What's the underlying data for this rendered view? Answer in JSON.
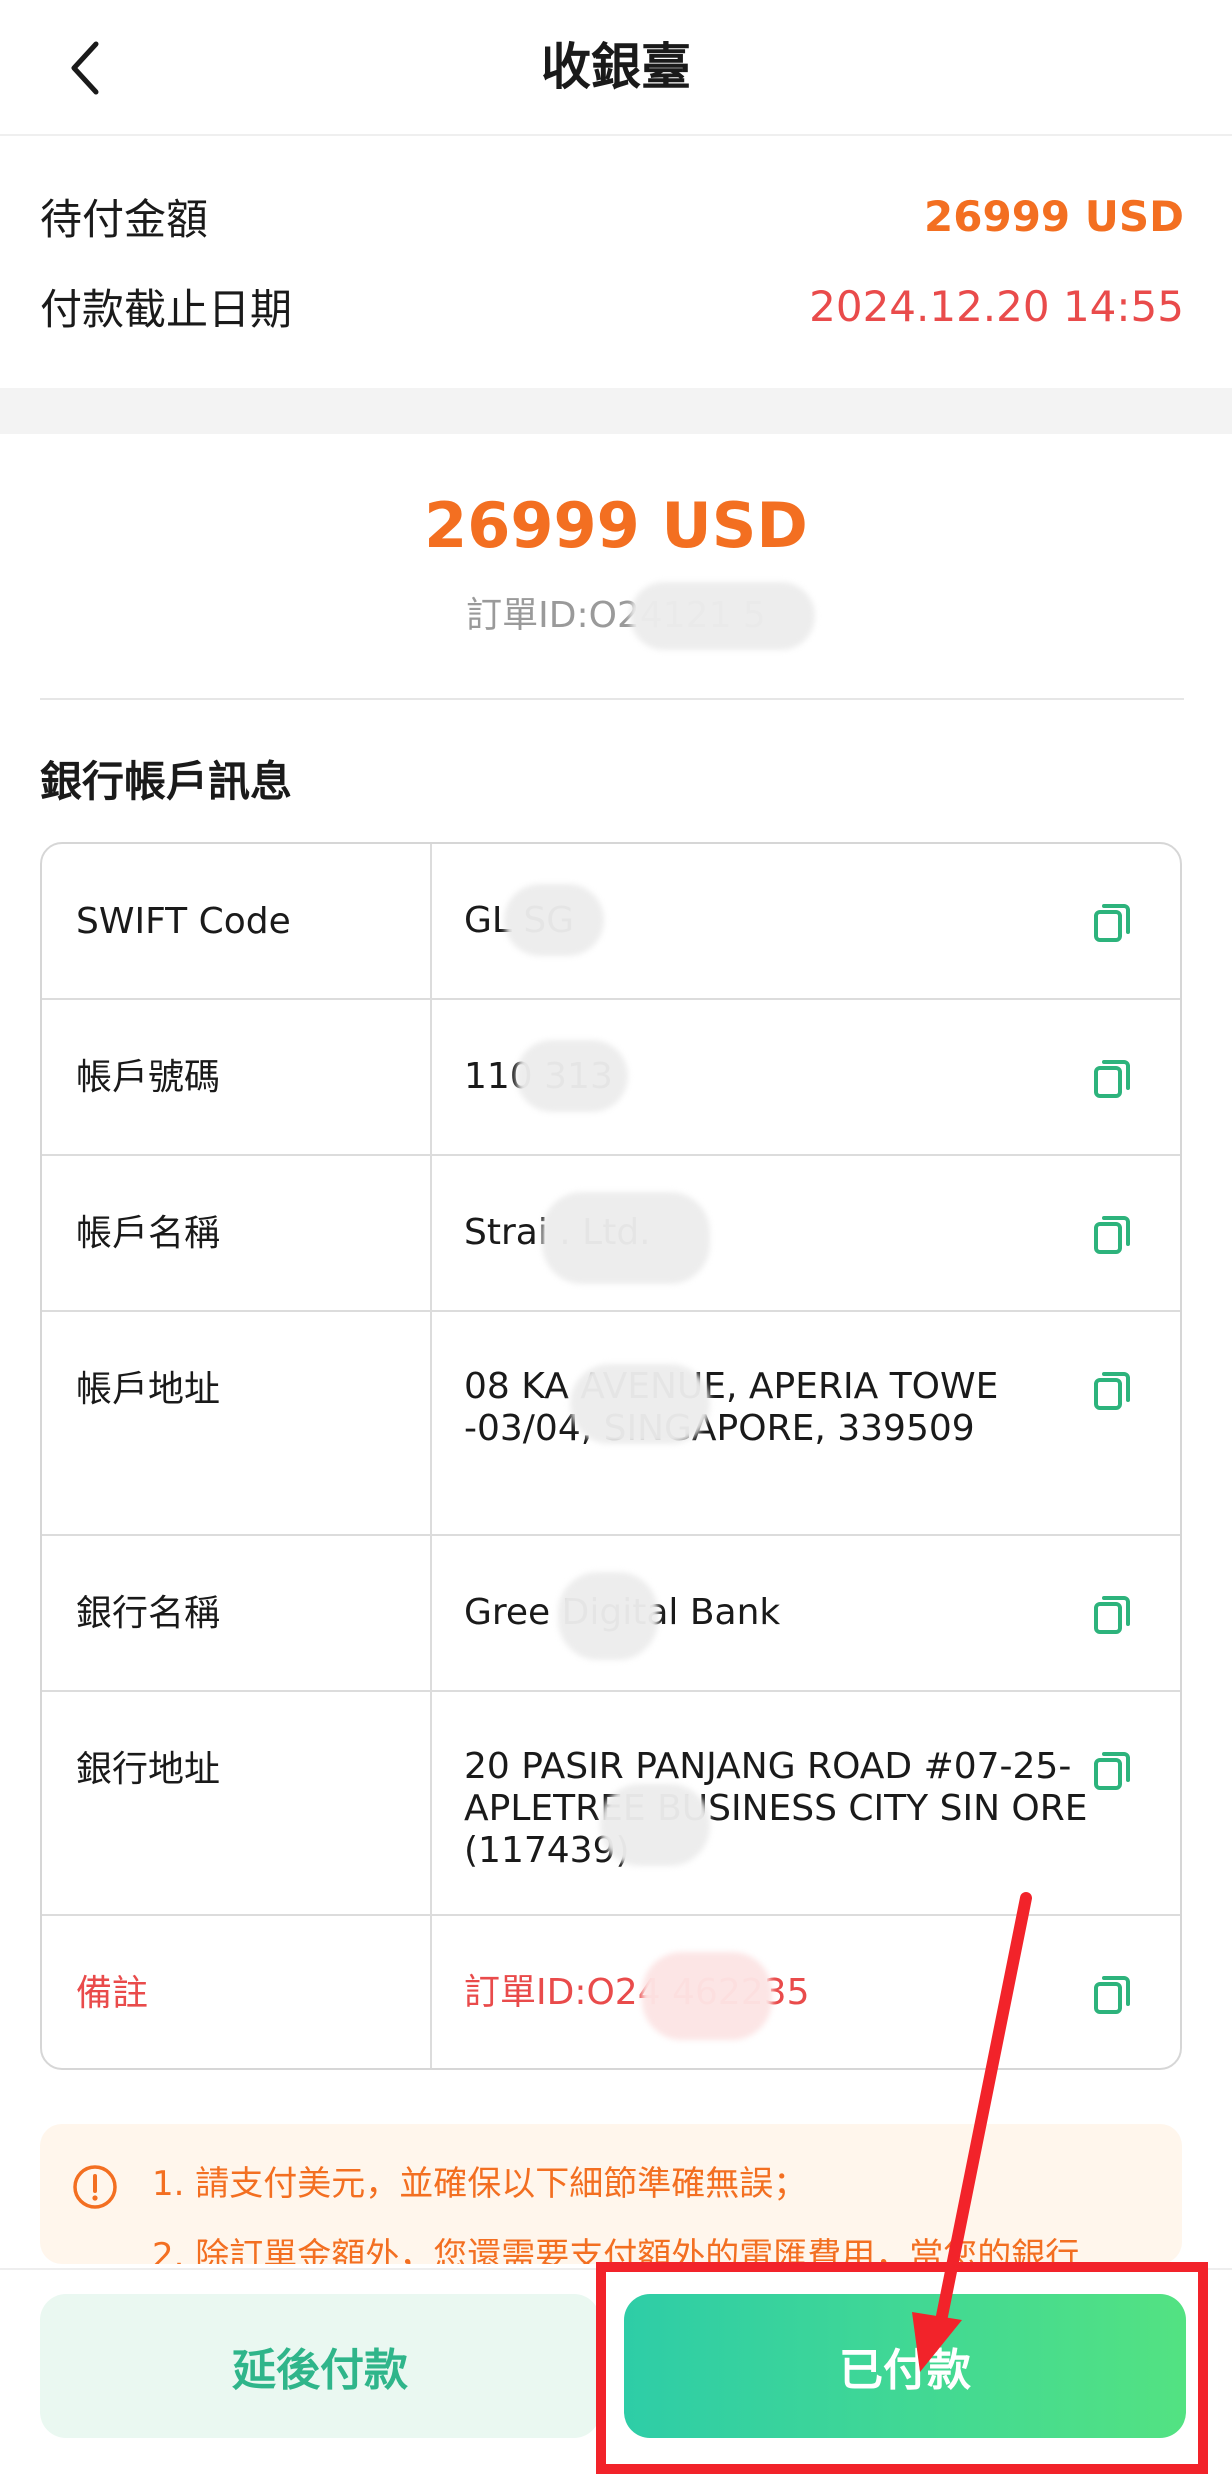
{
  "nav": {
    "title": "收銀臺"
  },
  "summary": {
    "amount_label": "待付金額",
    "amount_value": "26999 USD",
    "deadline_label": "付款截止日期",
    "deadline_value": "2024.12.20 14:55"
  },
  "payment": {
    "amount": "26999 USD",
    "order_id": "訂單ID:O24121        5"
  },
  "bank": {
    "section_title": "銀行帳戶訊息",
    "rows": [
      {
        "label": "SWIFT Code",
        "value": "GL        SG"
      },
      {
        "label": "帳戶號碼",
        "value": "110        313"
      },
      {
        "label": "帳戶名稱",
        "value": "Strai          . Ltd."
      },
      {
        "label": "帳戶地址",
        "value": "08 KA         AVENUE, APERIA TOWE        -03/04, SINGAPORE, 339509"
      },
      {
        "label": "銀行名稱",
        "value": "Gree         Digital Bank"
      },
      {
        "label": "銀行地址",
        "value": "20 PASIR PANJANG ROAD #07-25-        APLETREE BUSINESS CITY SIN       ORE (117439)"
      },
      {
        "label": "備註",
        "value": "訂單ID:O24          462235"
      }
    ]
  },
  "notice": {
    "line1": "1. 請支付美元，並確保以下細節準確無誤；",
    "line2": "2. 除訂單金額外，您還需要支付額外的電匯費用，當您的銀行"
  },
  "buttons": {
    "later": "延後付款",
    "paid": "已付款"
  },
  "colors": {
    "accent_orange": "#F36F21",
    "deadline_red": "#E94B4B",
    "primary_green": "#2ECDA7",
    "annotation_red": "#F2232A"
  }
}
